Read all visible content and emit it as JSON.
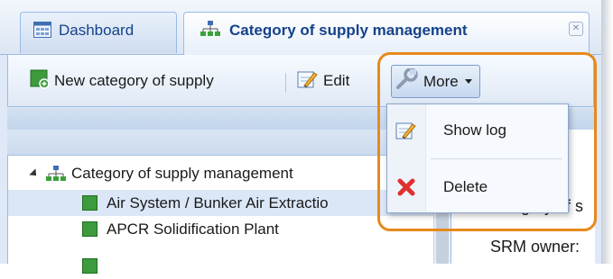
{
  "tabs": [
    {
      "label": "Dashboard",
      "icon": "dashboard-icon",
      "active": false
    },
    {
      "label": "Category of supply management",
      "icon": "hierarchy-icon",
      "active": true,
      "closable": true
    }
  ],
  "toolbar": {
    "new_label": "New category of supply",
    "edit_label": "Edit",
    "more_label": "More"
  },
  "menu": {
    "items": [
      {
        "label": "Show log",
        "icon": "log-icon"
      },
      {
        "label": "Delete",
        "icon": "delete-icon"
      }
    ]
  },
  "tree": {
    "root": {
      "label": "Category of supply management",
      "icon": "hierarchy-icon",
      "expanded": true
    },
    "children": [
      {
        "label": "Air System / Bunker Air Extractio",
        "selected": true
      },
      {
        "label": "APCR Solidification Plant",
        "selected": false
      },
      {
        "label": "",
        "selected": false
      }
    ]
  },
  "details": {
    "line1": "ategc",
    "line2": "category of s",
    "line3": "SRM owner:"
  },
  "colors": {
    "accent": "#15428b",
    "highlight": "#e68a1c",
    "leaf": "#3d9a3d",
    "delete": "#e03030"
  }
}
